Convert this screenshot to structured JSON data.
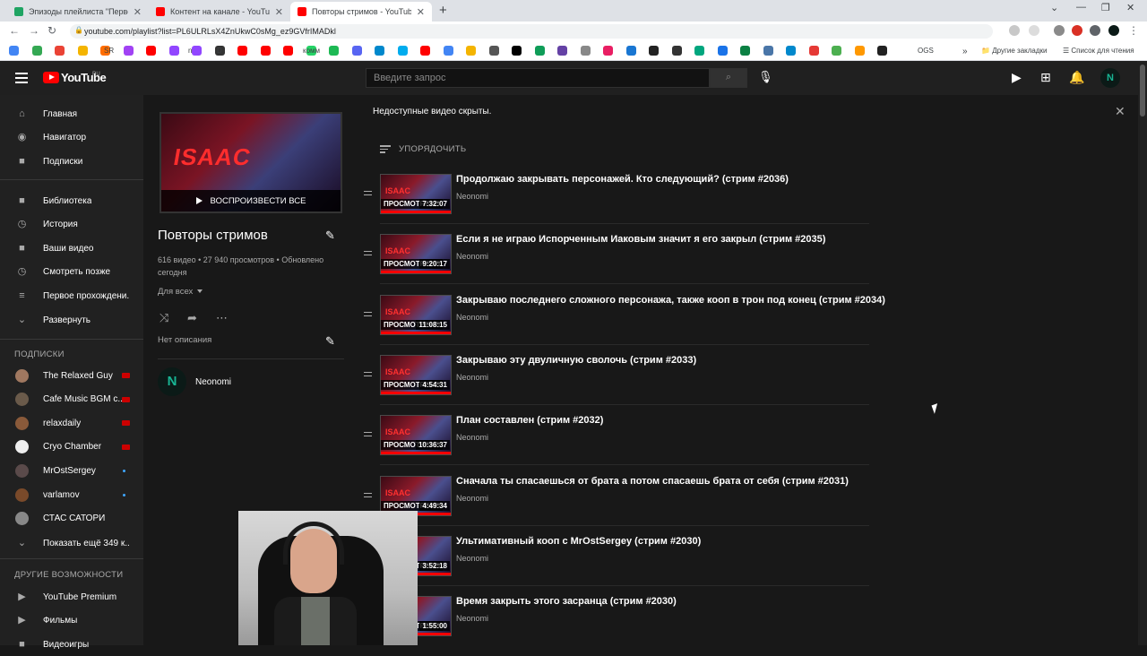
{
  "browser": {
    "tabs": [
      {
        "label": "Эпизоды плейлиста \"Первое пр",
        "color": "#1fa463",
        "active": false
      },
      {
        "label": "Контент на канале - YouTube St",
        "color": "#ff0000",
        "active": false
      },
      {
        "label": "Повторы стримов - YouTube",
        "color": "#ff0000",
        "active": true
      }
    ],
    "new_tab": "+",
    "url": "youtube.com/playlist?list=PL6ULRLsX4ZnUkwC0sMg_ez9GVfrIMADkl",
    "bookmarks": [
      {
        "label": "SR"
      },
      {
        "label": "D"
      },
      {
        "label": "n"
      },
      {
        "label": "комм"
      },
      {
        "label": "OGS"
      }
    ],
    "other_bookmarks": "Другие закладки",
    "reading_list": "Список для чтения"
  },
  "masthead": {
    "logo_text": "YouTube",
    "region": "RU",
    "search_placeholder": "Введите запрос",
    "avatar_text": "N"
  },
  "guide": {
    "main": [
      {
        "label": "Главная",
        "icon": "home-icon"
      },
      {
        "label": "Навигатор",
        "icon": "compass-icon"
      },
      {
        "label": "Подписки",
        "icon": "subscriptions-icon"
      }
    ],
    "library": [
      {
        "label": "Библиотека",
        "icon": "library-icon"
      },
      {
        "label": "История",
        "icon": "history-icon"
      },
      {
        "label": "Ваши видео",
        "icon": "your-videos-icon"
      },
      {
        "label": "Смотреть позже",
        "icon": "watch-later-icon"
      },
      {
        "label": "Первое прохождени...",
        "icon": "playlist-icon"
      },
      {
        "label": "Развернуть",
        "icon": "chevron-down-icon"
      }
    ],
    "subscriptions_title": "ПОДПИСКИ",
    "subscriptions": [
      {
        "label": "The Relaxed Guy",
        "color": "#a07860",
        "status": "live"
      },
      {
        "label": "Cafe Music BGM c...",
        "color": "#6a5a4a",
        "status": "live"
      },
      {
        "label": "relaxdaily",
        "color": "#8a5a3a",
        "status": "live"
      },
      {
        "label": "Cryo Chamber",
        "color": "#eeeeee",
        "status": "live"
      },
      {
        "label": "MrOstSergey",
        "color": "#5a4a4a",
        "status": "new"
      },
      {
        "label": "varlamov",
        "color": "#7a4a2a",
        "status": "new"
      },
      {
        "label": "СТАС САТОРИ",
        "color": "#888888",
        "status": "none"
      }
    ],
    "show_more": "Показать ещё 349 к...",
    "more_title": "ДРУГИЕ ВОЗМОЖНОСТИ",
    "more": [
      {
        "label": "YouTube Premium",
        "icon": "youtube-premium-icon"
      },
      {
        "label": "Фильмы",
        "icon": "movies-icon"
      },
      {
        "label": "Видеоигры",
        "icon": "gaming-icon"
      }
    ]
  },
  "playlist": {
    "play_all": "ВОСПРОИЗВЕСТИ ВСЕ",
    "thumb_text": "ISAAC",
    "title": "Повторы стримов",
    "meta": "616 видео • 27 940 просмотров • Обновлено сегодня",
    "privacy": "Для всех",
    "description": "Нет описания",
    "owner": "Neonomi",
    "owner_avatar": "N"
  },
  "content": {
    "notice": "Недоступные видео скрыты.",
    "sort_label": "УПОРЯДОЧИТЬ",
    "videos": [
      {
        "title": "Продолжаю закрывать персонажей. Кто следующий? (стрим #2036)",
        "channel": "Neonomi",
        "duration": "7:32:07",
        "watched": "ПРОСМОТРЕНО"
      },
      {
        "title": "Если я не играю Испорченным Иаковым значит я его закрыл (стрим #2035)",
        "channel": "Neonomi",
        "duration": "9:20:17",
        "watched": "ПРОСМОТРЕНО"
      },
      {
        "title": "Закрываю последнего сложного персонажа, также кооп в трон под конец (стрим #2034)",
        "channel": "Neonomi",
        "duration": "11:08:15",
        "watched": "ПРОСМОТРЕНО"
      },
      {
        "title": "Закрываю эту двуличную сволочь (стрим #2033)",
        "channel": "Neonomi",
        "duration": "4:54:31",
        "watched": "ПРОСМОТРЕНО"
      },
      {
        "title": "План составлен (стрим #2032)",
        "channel": "Neonomi",
        "duration": "10:36:37",
        "watched": "ПРОСМОТРЕНО"
      },
      {
        "title": "Сначала ты спасаешься от брата а потом спасаешь брата от себя (стрим #2031)",
        "channel": "Neonomi",
        "duration": "4:49:34",
        "watched": "ПРОСМОТРЕНО"
      },
      {
        "title": "Ультимативный кооп с MrOstSergey (стрим #2030)",
        "channel": "Neonomi",
        "duration": "3:52:18",
        "watched": "ПРОСМОТРЕНО"
      },
      {
        "title": "Время закрыть этого засранца (стрим #2030)",
        "channel": "Neonomi",
        "duration": "1:55:00",
        "watched": "ПРОСМОТРЕНО"
      }
    ]
  }
}
